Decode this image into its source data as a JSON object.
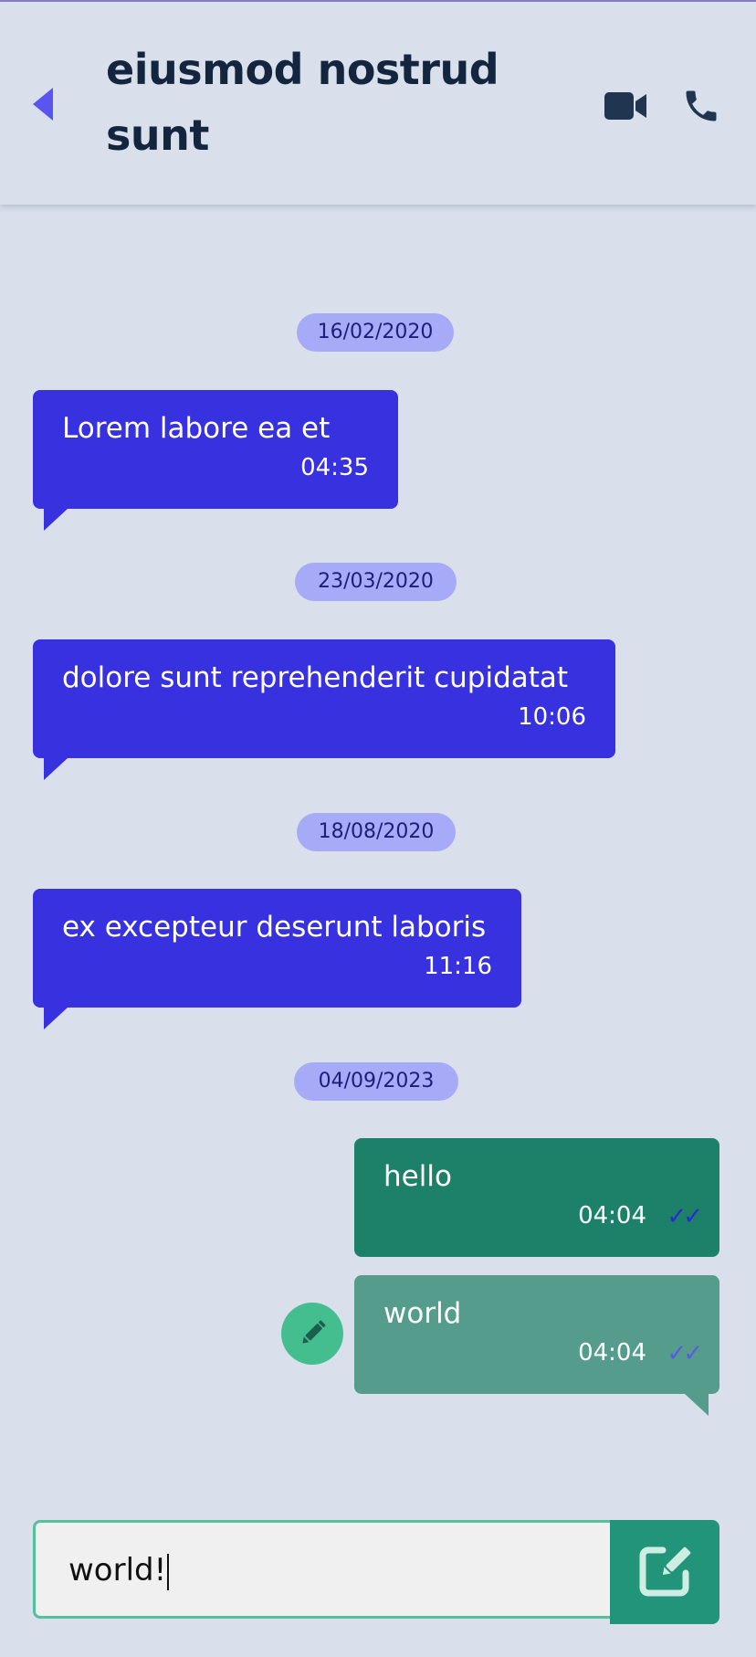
{
  "header": {
    "title": "eiusmod nostrud sunt",
    "back_icon": "back-arrow-icon",
    "video_icon": "video-camera-icon",
    "phone_icon": "phone-icon"
  },
  "messages": [
    {
      "date": "16/02/2020",
      "text": "Lorem labore ea et",
      "time": "04:35",
      "direction": "incoming"
    },
    {
      "date": "23/03/2020",
      "text": "dolore sunt reprehenderit cupidatat",
      "time": "10:06",
      "direction": "incoming"
    },
    {
      "date": "18/08/2020",
      "text": "ex excepteur deserunt laboris",
      "time": "11:16",
      "direction": "incoming"
    },
    {
      "date": "04/09/2023",
      "text": "hello",
      "time": "04:04",
      "direction": "outgoing",
      "status": "read"
    },
    {
      "text": "world",
      "time": "04:04",
      "direction": "outgoing",
      "status": "read",
      "editing": true
    }
  ],
  "composer": {
    "value": "world!",
    "send_icon": "edit-icon",
    "edit_icon": "pencil-icon"
  },
  "colors": {
    "background": "#d9e0eb",
    "incoming_bubble": "#3731e0",
    "outgoing_bubble": "#1d8068",
    "editing_bubble": "#559c8c",
    "date_pill": "#a7aaf7",
    "accent": "#21947a"
  }
}
